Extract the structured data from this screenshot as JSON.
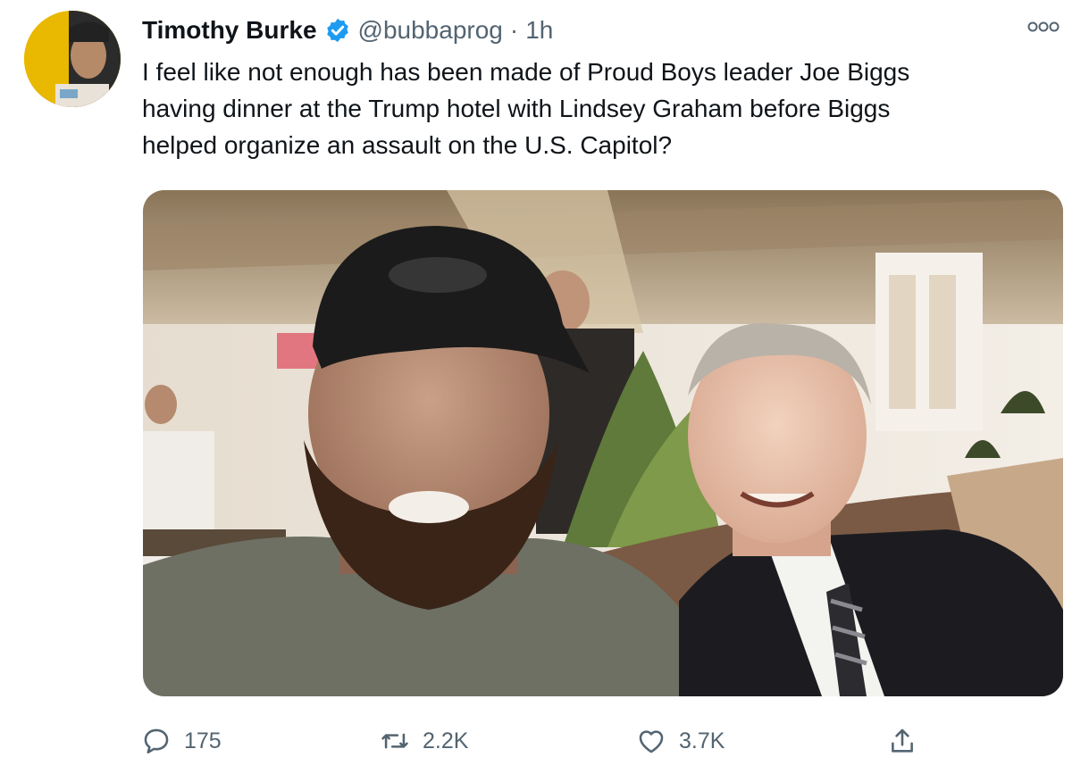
{
  "tweet": {
    "author": {
      "display_name": "Timothy Burke",
      "handle": "@bubbaprog",
      "verified": true
    },
    "separator": "·",
    "time": "1h",
    "text_lines": [
      "I feel like not enough has been made of Proud Boys leader Joe Biggs",
      "having dinner at the Trump hotel with Lindsey Graham  before Biggs",
      "helped organize an assault on the U.S. Capitol?"
    ],
    "stats": {
      "replies": "175",
      "retweets": "2.2K",
      "likes": "3.7K"
    }
  },
  "icons": {
    "verified": "verified-badge-icon",
    "more": "more-options-icon",
    "reply": "reply-icon",
    "retweet": "retweet-icon",
    "like": "heart-icon",
    "share": "share-icon"
  },
  "colors": {
    "verified_blue": "#1d9bf0",
    "secondary_text": "#536471",
    "primary_text": "#0f1419"
  }
}
